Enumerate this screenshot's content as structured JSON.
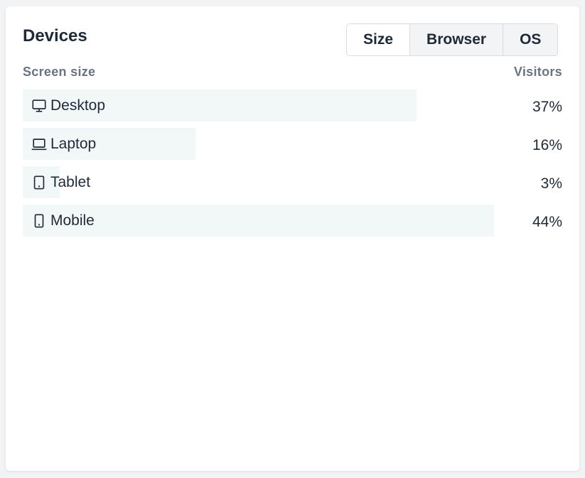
{
  "card": {
    "title": "Devices",
    "tabs": [
      {
        "label": "Size",
        "active": true
      },
      {
        "label": "Browser",
        "active": false
      },
      {
        "label": "OS",
        "active": false
      }
    ],
    "columns": {
      "left": "Screen size",
      "right": "Visitors"
    },
    "bar_color": "#f1f8f7",
    "rows": [
      {
        "label": "Desktop",
        "icon": "desktop-icon",
        "value": "37%",
        "share": 0.73
      },
      {
        "label": "Laptop",
        "icon": "laptop-icon",
        "value": "16%",
        "share": 0.32
      },
      {
        "label": "Tablet",
        "icon": "tablet-icon",
        "value": "3%",
        "share": 0.068
      },
      {
        "label": "Mobile",
        "icon": "mobile-icon",
        "value": "44%",
        "share": 0.873
      }
    ]
  }
}
